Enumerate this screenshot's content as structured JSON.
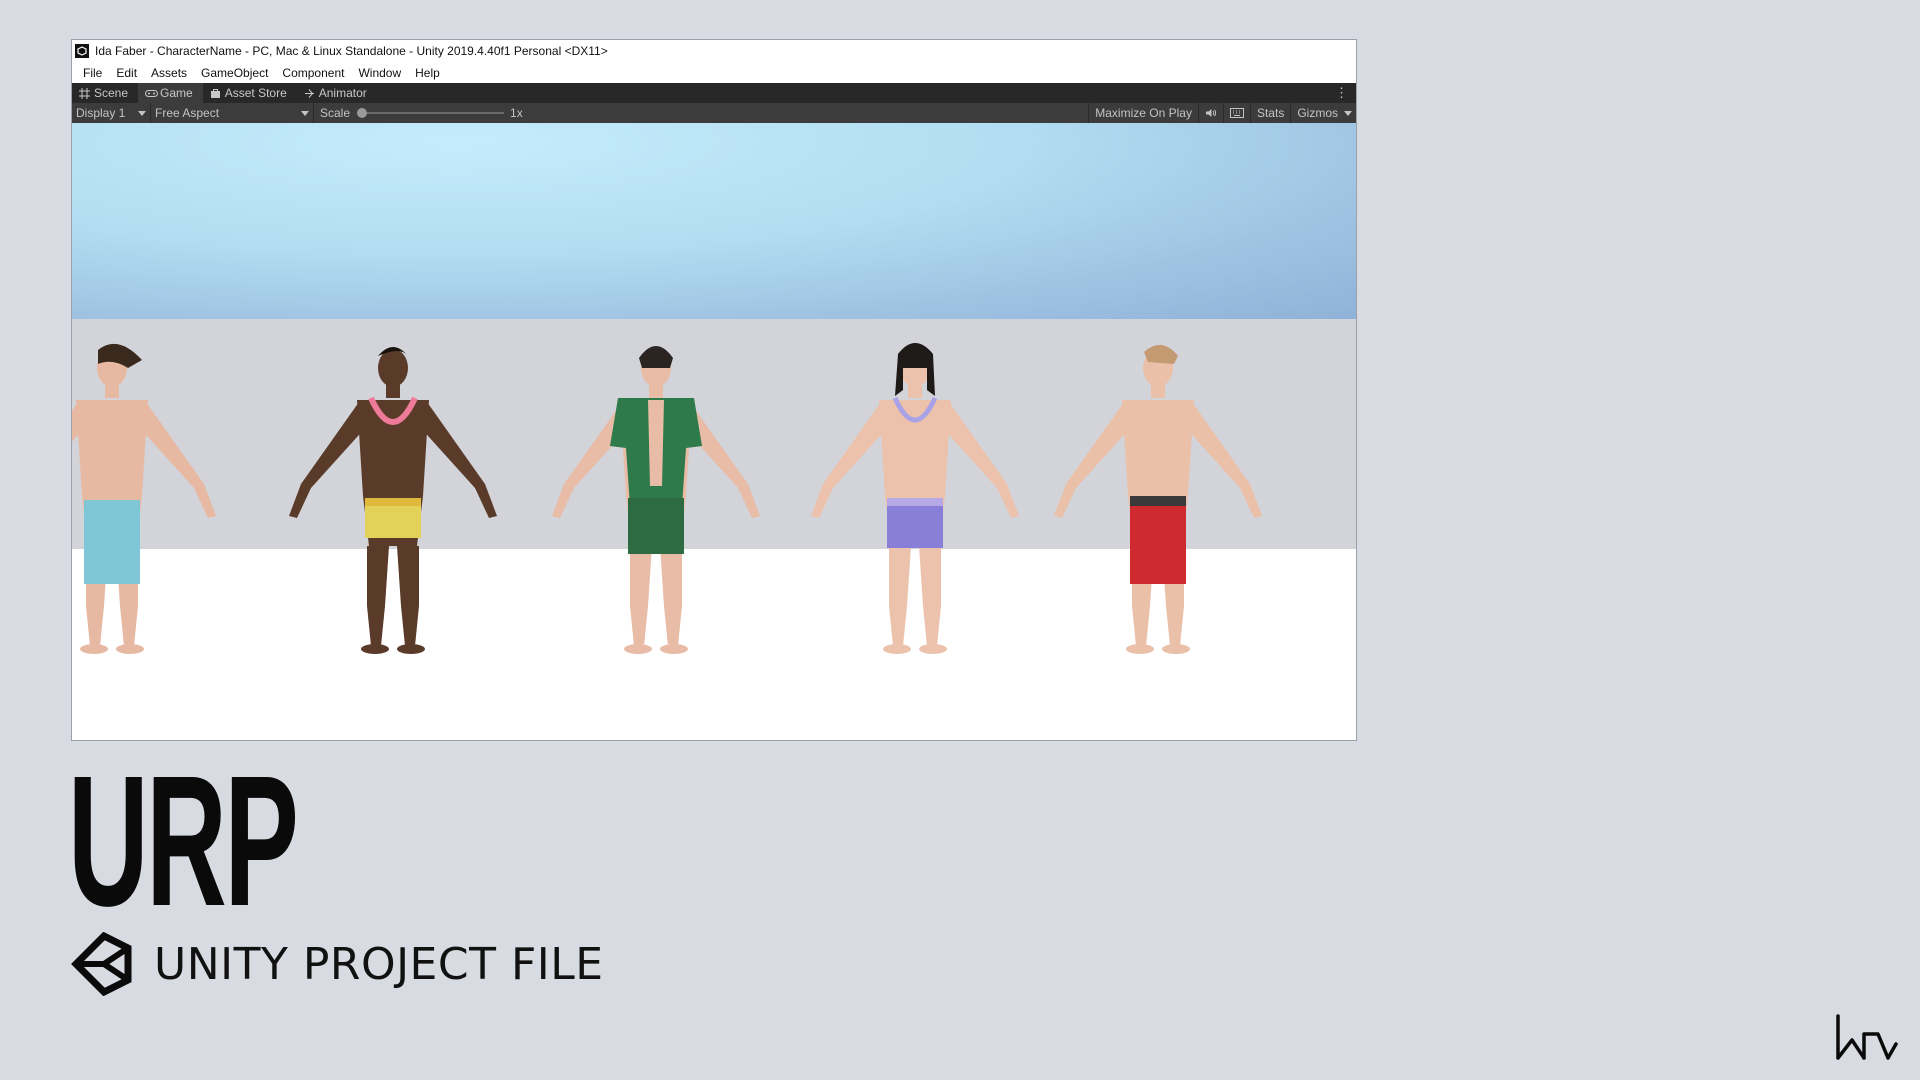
{
  "window": {
    "title": "Ida Faber - CharacterName - PC, Mac & Linux Standalone - Unity 2019.4.40f1 Personal <DX11>"
  },
  "menu": [
    "File",
    "Edit",
    "Assets",
    "GameObject",
    "Component",
    "Window",
    "Help"
  ],
  "tabs": [
    {
      "label": "Scene",
      "icon": "grid-icon"
    },
    {
      "label": "Game",
      "icon": "gamepad-icon"
    },
    {
      "label": "Asset Store",
      "icon": "shopping-bag-icon"
    },
    {
      "label": "Animator",
      "icon": "animator-icon"
    }
  ],
  "toolbar": {
    "display": "Display 1",
    "aspect": "Free Aspect",
    "scale_label": "Scale",
    "scale_value": "1x",
    "maximize": "Maximize On Play",
    "stats": "Stats",
    "gizmos": "Gizmos"
  },
  "caption": {
    "title": "URP",
    "subtitle": "UNITY PROJECT FILE"
  },
  "colors": {
    "page_bg": "#d8dbe1",
    "editor_dark": "#282828",
    "editor_toolbar": "#3c3c3c",
    "sky": "#b2dcf1",
    "backdrop": "#d2d4da"
  }
}
